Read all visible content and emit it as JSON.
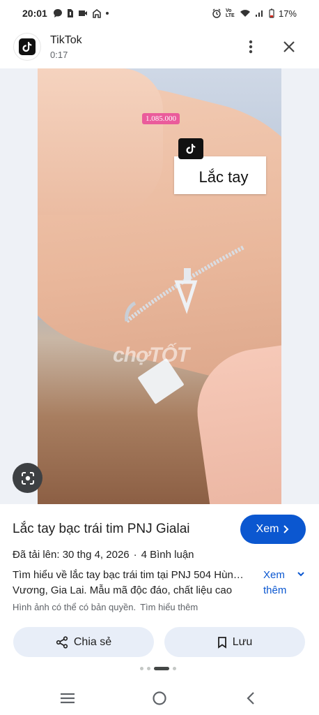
{
  "status_bar": {
    "time": "20:01",
    "battery": "17%",
    "net_label": "Vo LTE"
  },
  "app": {
    "name": "TikTok",
    "duration": "0:17"
  },
  "image": {
    "price_tag": "1.085.000",
    "card_text": "Lắc tay",
    "watermark": "chợTỐT"
  },
  "result": {
    "title": "Lắc tay bạc trái tim PNJ Gialai",
    "visit_label": "Xem",
    "uploaded": "Đã tải lên: 30 thg 4, 2026",
    "separator": "·",
    "comments": "4 Bình luận",
    "desc_line1": "Tìm hiểu về lắc tay bạc trái tim tại PNJ 504 Hùn…",
    "desc_line2": "Vương, Gia Lai. Mẫu mã độc đáo, chất liệu cao",
    "more_label_1": "Xem",
    "more_label_2": "thêm",
    "copyright": "Hình ảnh có thể có bản quyền.",
    "learn_more": "Tìm hiểu thêm"
  },
  "actions": {
    "share": "Chia sẻ",
    "save": "Lưu"
  },
  "colors": {
    "accent": "#0b57d0",
    "button_bg": "#e8eef8",
    "price_tag": "#ea5c9b"
  },
  "icons": [
    "chat-bubble-icon",
    "sim-icon",
    "media-icon",
    "home-icon",
    "alarm-icon",
    "wifi-icon",
    "signal-icon",
    "battery-icon",
    "tiktok-logo-icon",
    "more-vert-icon",
    "close-icon",
    "lens-icon",
    "chevron-right-icon",
    "chevron-down-icon",
    "share-icon",
    "bookmark-icon",
    "menu-icon",
    "home-circle-icon",
    "back-icon"
  ]
}
